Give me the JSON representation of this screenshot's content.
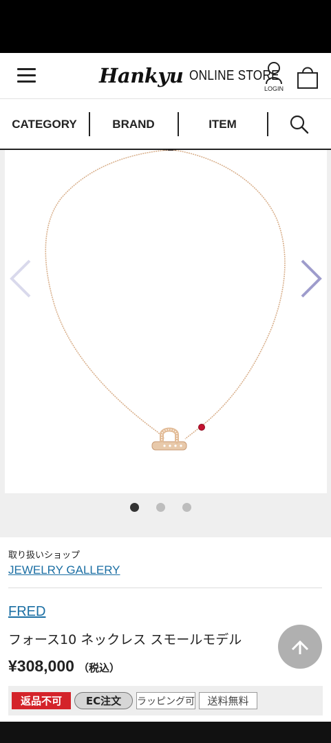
{
  "header": {
    "logo_main": "Hankyu",
    "logo_sub": "ONLINE STORE",
    "login_label": "LOGIN",
    "icons": {
      "menu": "hamburger-icon",
      "login": "user-icon",
      "cart": "shopping-bag-icon"
    }
  },
  "nav": {
    "category": "CATEGORY",
    "brand": "BRAND",
    "item": "ITEM",
    "search_icon": "search-icon"
  },
  "gallery": {
    "image": "rose-gold-necklace-with-horseshoe-pendant",
    "total_slides": 3,
    "active_slide": 1,
    "arrow_color": "#9e9ccc"
  },
  "shop": {
    "label": "取り扱いショップ",
    "name": "JEWELRY GALLERY"
  },
  "product": {
    "brand": "FRED",
    "name": "フォース10 ネックレス スモールモデル",
    "price": "¥308,000",
    "tax_note": "（税込）"
  },
  "tags": {
    "no_return": "返品不可",
    "ec_order": "EC注文",
    "wrapping": "ラッピング可",
    "free_shipping": "送料無料"
  },
  "colors": {
    "link": "#1a6ea3",
    "no_return_tag": "#d4232a",
    "chain": "#d9b08c",
    "ruby": "#c4122f"
  }
}
